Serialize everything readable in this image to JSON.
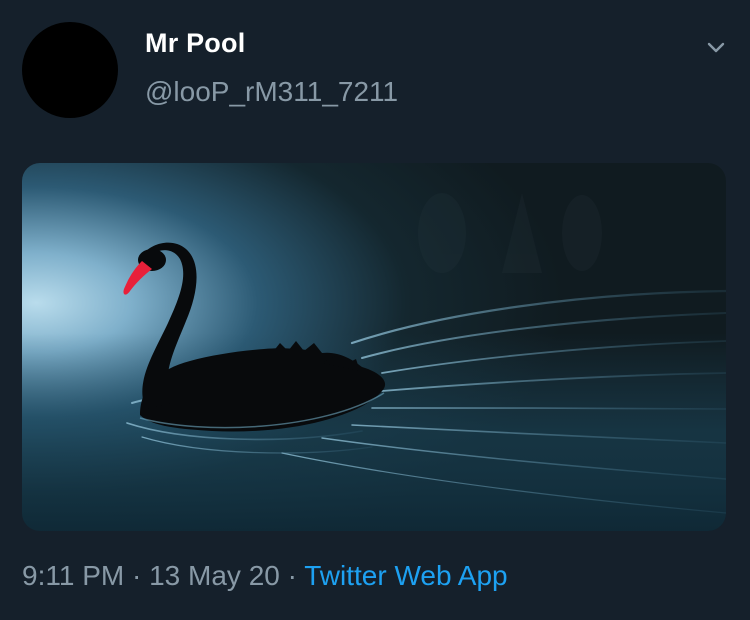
{
  "tweet": {
    "display_name": "Mr Pool",
    "handle": "@looP_rM311_7211",
    "time": "9:11 PM",
    "separator": " · ",
    "date": "13 May 20",
    "source": "Twitter Web App"
  },
  "icons": {
    "menu": "chevron-down-icon",
    "avatar": "avatar-placeholder"
  },
  "media": {
    "subject": "black swan on dark water",
    "colors": {
      "water_light": "#9cc6dc",
      "water_mid": "#2f5f7a",
      "water_dark": "#0f1c22",
      "beak": "#e8203a"
    }
  },
  "colors": {
    "background": "#15202b",
    "name": "#ffffff",
    "secondary": "#8899a6",
    "link": "#1da1f2"
  }
}
